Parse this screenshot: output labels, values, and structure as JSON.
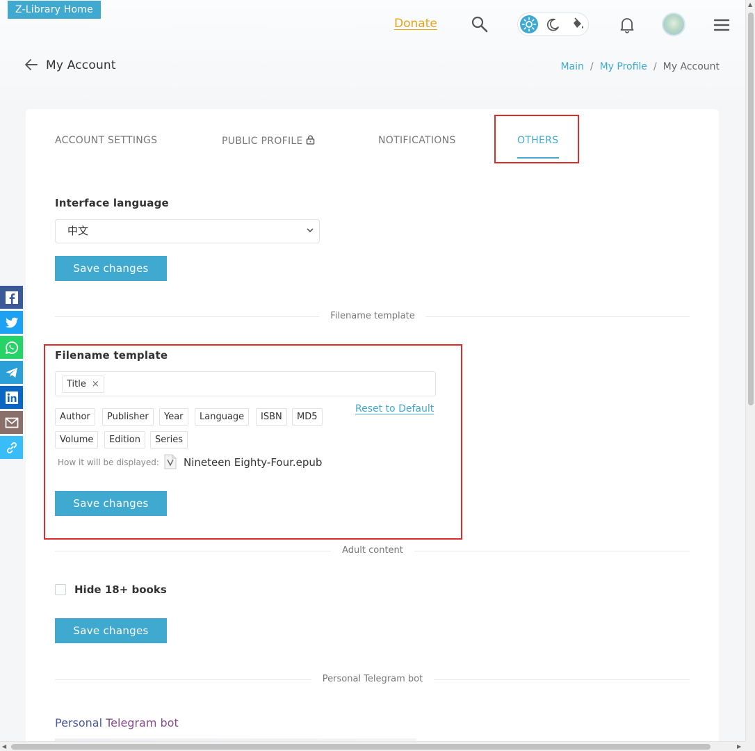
{
  "header": {
    "home_label": "Z-Library Home",
    "donate_label": "Donate",
    "icons": [
      "search-icon",
      "sun-icon",
      "moon-icon",
      "paint-bucket-icon",
      "bell-icon",
      "avatar",
      "hamburger-menu-icon"
    ]
  },
  "page": {
    "title": "My Account",
    "breadcrumb": [
      "Main",
      "My Profile",
      "My Account"
    ]
  },
  "tabs": [
    {
      "label": "ACCOUNT SETTINGS",
      "active": false
    },
    {
      "label": "PUBLIC PROFILE",
      "active": false,
      "icon": "lock-icon"
    },
    {
      "label": "NOTIFICATIONS",
      "active": false
    },
    {
      "label": "OTHERS",
      "active": true
    }
  ],
  "interface_language": {
    "label": "Interface language",
    "selected": "中文",
    "save_label": "Save changes"
  },
  "filename_template": {
    "section_title": "Filename template",
    "label": "Filename template",
    "selected_tags": [
      "Title"
    ],
    "remove_glyph": "×",
    "available_fields": [
      "Author",
      "Publisher",
      "Year",
      "Language",
      "ISBN",
      "MD5",
      "Volume",
      "Edition",
      "Series"
    ],
    "reset_label": "Reset to Default",
    "preview_label": "How it will be displayed:",
    "preview_filename": "Nineteen Eighty-Four.epub",
    "save_label": "Save changes"
  },
  "adult_content": {
    "section_title": "Adult content",
    "checkbox_label": "Hide 18+ books",
    "checked": false,
    "save_label": "Save changes"
  },
  "telegram": {
    "section_title": "Personal Telegram bot",
    "title_part1": "Personal",
    "title_part2": "Telegram bot"
  },
  "share_buttons": [
    "facebook",
    "twitter",
    "whatsapp",
    "telegram",
    "linkedin",
    "email",
    "copy-link"
  ],
  "colors": {
    "accent": "#3fa9cf",
    "donate": "#e8a317",
    "highlight": "#e02a2a",
    "facebook": "#3b5998",
    "twitter": "#1da1f2",
    "whatsapp": "#25d366",
    "telegram": "#2a9fd8",
    "linkedin": "#0a66c2",
    "email": "#8b6f6a",
    "copy_link": "#38bdf8"
  }
}
